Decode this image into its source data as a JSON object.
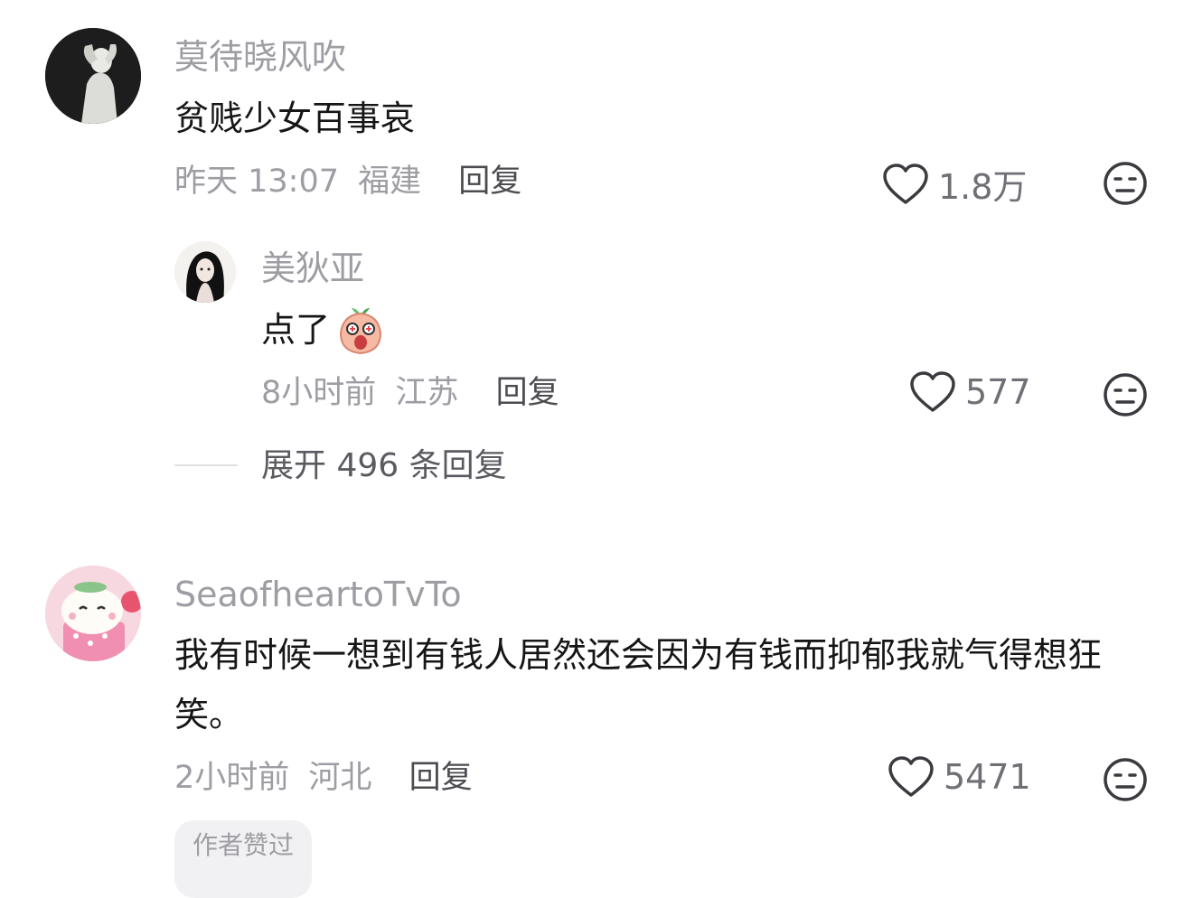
{
  "comments": [
    {
      "username": "莫待晓风吹",
      "text": "贫贱少女百事哀",
      "time": "昨天 13:07",
      "location": "福建",
      "reply_label": "回复",
      "likes": "1.8万"
    },
    {
      "username": "美狄亚",
      "text": "点了",
      "emoji": "peach-face-emoji",
      "time": "8小时前",
      "location": "江苏",
      "reply_label": "回复",
      "likes": "577"
    },
    {
      "username": "SeaofheartoTvTo",
      "text": "我有时候一想到有钱人居然还会因为有钱而抑郁我就气得想狂笑。",
      "time": "2小时前",
      "location": "河北",
      "reply_label": "回复",
      "likes": "5471"
    }
  ],
  "expand_replies": "展开 496 条回复",
  "bottom_tag": "作者赞过",
  "icons": {
    "like": "heart-outline-icon",
    "dislike": "meh-face-icon"
  },
  "colors": {
    "meta_gray": "#9d9da3",
    "text": "#161616",
    "reply": "#4b4b50"
  }
}
